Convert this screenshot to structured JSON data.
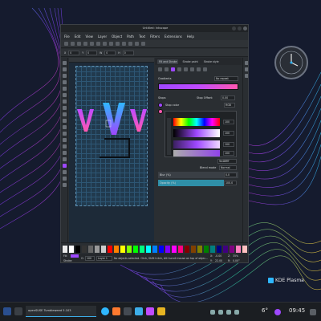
{
  "window": {
    "title": "Untitled: Inkscape",
    "menu": [
      "File",
      "Edit",
      "View",
      "Layer",
      "Object",
      "Path",
      "Text",
      "Filters",
      "Extensions",
      "Help"
    ],
    "ctrl": {
      "x_label": "X",
      "x_value": "0",
      "y_label": "Y",
      "y_value": "0",
      "w_label": "W",
      "w_value": "0",
      "h_label": "H",
      "h_value": "0"
    }
  },
  "dock": {
    "tabs": [
      "Fill and Stroke",
      "Stroke paint",
      "Stroke style"
    ],
    "gradient_label": "Gradients",
    "gradient_repeat": "No repeat",
    "stops_label": "Stops",
    "stop_offset_label": "Stop Offset:",
    "stop_offset_value": "0.00",
    "stop_color_label": "Stop color",
    "stop_rgba": "RGB",
    "hex_value": "9e48ffff",
    "values": [
      "100",
      "100",
      "100",
      "100"
    ],
    "blend_label": "Blend mode",
    "blend_value": "Normal",
    "blur_label": "Blur (%)",
    "blur_value": "0.0",
    "opacity_label": "Opacity (%)",
    "opacity_value": "100.0"
  },
  "status": {
    "fill_label": "Fill:",
    "stroke_label": "Stroke:",
    "opacity_short": "O:",
    "opacity_val": "100",
    "layer": "Layer 1",
    "message": "No objects selected. Click, Shift+click, Alt+scroll mouse on top of objects, or drag around objects to select.",
    "x_label": "X:",
    "x_val": "-0.00",
    "y_label": "Y:",
    "y_val": "22.00",
    "z_label": "Z:",
    "zoom": "35%",
    "r_label": "R:",
    "rotation": "0.00°"
  },
  "desktop": {
    "plasma_label": "KDE Plasma",
    "taskbar_window": "openSUSE Tumbleweed 5.103",
    "clock_time": "09:45",
    "weather": "6°"
  },
  "colors": {
    "accent_purple": "#9e48ff",
    "accent_cyan": "#2fb7ff",
    "panel_bg": "#2a2e32"
  }
}
